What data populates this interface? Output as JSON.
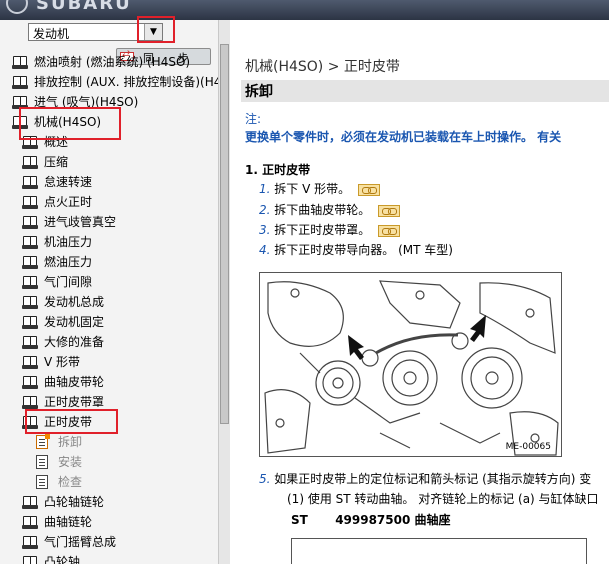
{
  "banner": {
    "logo": "SUBARU"
  },
  "left": {
    "system_select": {
      "value": "发动机"
    },
    "sync_button": "同 步",
    "tree": [
      {
        "label": "燃油喷射 (燃油系统) (H4SO)",
        "type": "book",
        "level": 0
      },
      {
        "label": "排放控制 (AUX. 排放控制设备)(H4",
        "type": "book",
        "level": 0
      },
      {
        "label": "进气 (吸气)(H4SO)",
        "type": "book",
        "level": 0
      },
      {
        "label": "机械(H4SO)",
        "type": "book",
        "level": 0
      },
      {
        "label": "概述",
        "type": "book",
        "level": 1
      },
      {
        "label": "压缩",
        "type": "book",
        "level": 1
      },
      {
        "label": "怠速转速",
        "type": "book",
        "level": 1
      },
      {
        "label": "点火正时",
        "type": "book",
        "level": 1
      },
      {
        "label": "进气歧管真空",
        "type": "book",
        "level": 1
      },
      {
        "label": "机油压力",
        "type": "book",
        "level": 1
      },
      {
        "label": "燃油压力",
        "type": "book",
        "level": 1
      },
      {
        "label": "气门间隙",
        "type": "book",
        "level": 1
      },
      {
        "label": "发动机总成",
        "type": "book",
        "level": 1
      },
      {
        "label": "发动机固定",
        "type": "book",
        "level": 1
      },
      {
        "label": "大修的准备",
        "type": "book",
        "level": 1
      },
      {
        "label": "V 形带",
        "type": "book",
        "level": 1
      },
      {
        "label": "曲轴皮带轮",
        "type": "book",
        "level": 1
      },
      {
        "label": "正时皮带罩",
        "type": "book",
        "level": 1
      },
      {
        "label": "正时皮带",
        "type": "book",
        "level": 1
      },
      {
        "label": "拆卸",
        "type": "doc-active",
        "level": 2
      },
      {
        "label": "安装",
        "type": "doc",
        "level": 2
      },
      {
        "label": "检查",
        "type": "doc",
        "level": 2
      },
      {
        "label": "凸轮轴链轮",
        "type": "book",
        "level": 1
      },
      {
        "label": "曲轴链轮",
        "type": "book",
        "level": 1
      },
      {
        "label": "气门摇臂总成",
        "type": "book",
        "level": 1
      },
      {
        "label": "凸轮轴",
        "type": "book",
        "level": 1
      }
    ]
  },
  "main": {
    "breadcrumb": "机械(H4SO) > 正时皮带",
    "section_title": "拆卸",
    "note_label": "注:",
    "note_text": "更换单个零件时，必须在发动机已装载在车上时操作。 有关",
    "step_heading": "1. 正时皮带",
    "steps": [
      {
        "num": "1.",
        "text": "拆下 V 形带。",
        "link": true
      },
      {
        "num": "2.",
        "text": "拆下曲轴皮带轮。",
        "link": true
      },
      {
        "num": "3.",
        "text": "拆下正时皮带罩。",
        "link": true
      },
      {
        "num": "4.",
        "text": "拆下正时皮带导向器。 (MT 车型)",
        "link": false
      }
    ],
    "figure_code": "ME-00065",
    "step5": {
      "num": "5.",
      "text": "如果正时皮带上的定位标记和箭头标记 (其指示旋转方向) 变"
    },
    "step5_sub": "(1) 使用 ST 转动曲轴。 对齐链轮上的标记 (a) 与缸体缺口",
    "tool": {
      "label": "ST",
      "value": "499987500 曲轴座"
    }
  },
  "colors": {
    "highlight": "#e0202a",
    "link_blue": "#1a56b0",
    "header_gray": "#e4e4e4"
  }
}
